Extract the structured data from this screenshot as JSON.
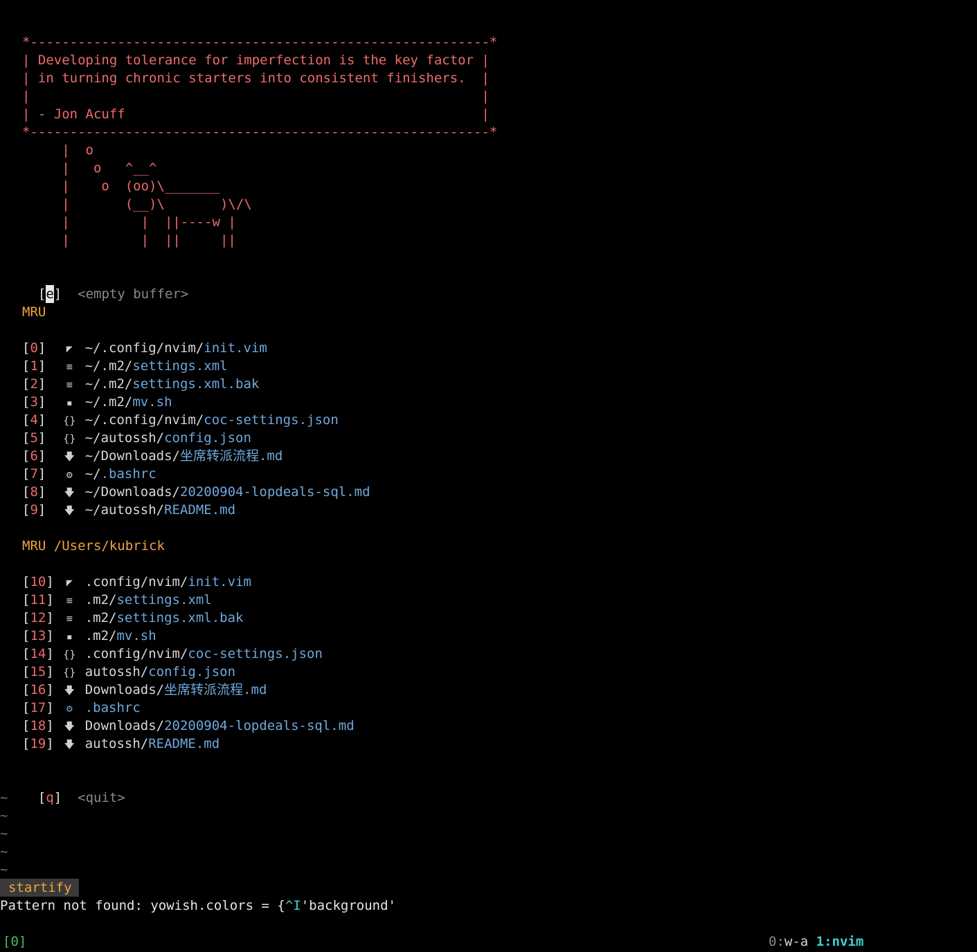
{
  "quote": {
    "border_top": "*----------------------------------------------------------*",
    "line1": "| Developing tolerance for imperfection is the key factor |",
    "line2": "| in turning chronic starters into consistent finishers.  |",
    "line3": "|                                                         |",
    "line4": "| - Jon Acuff                                             |",
    "border_bottom": "*----------------------------------------------------------*"
  },
  "cow": [
    "     |  o",
    "     |   o   ^__^",
    "     |    o  (oo)\\_______",
    "     |       (__)\\       )\\/\\",
    "     |         |  ||----w |",
    "     |         |  ||     ||"
  ],
  "empty_buffer": {
    "key": "e",
    "label": "<empty buffer>"
  },
  "mru": {
    "header": "MRU",
    "items": [
      {
        "index": "0",
        "icon": "vim-icon",
        "glyph": "◤",
        "dir": "~/.config/nvim/",
        "file": "init.vim"
      },
      {
        "index": "1",
        "icon": "file-lines-icon",
        "glyph": "≡",
        "dir": "~/.m2/",
        "file": "settings.xml"
      },
      {
        "index": "2",
        "icon": "file-lines-icon",
        "glyph": "≡",
        "dir": "~/.m2/",
        "file": "settings.xml.bak"
      },
      {
        "index": "3",
        "icon": "terminal-icon",
        "glyph": "▪",
        "dir": "~/.m2/",
        "file": "mv.sh"
      },
      {
        "index": "4",
        "icon": "braces-icon",
        "glyph": "{}",
        "dir": "~/.config/nvim/",
        "file": "coc-settings.json"
      },
      {
        "index": "5",
        "icon": "braces-icon",
        "glyph": "{}",
        "dir": "~/autossh/",
        "file": "config.json"
      },
      {
        "index": "6",
        "icon": "markdown-arrow-icon",
        "glyph": "🡇",
        "dir": "~/Downloads/",
        "file": "坐席转派流程.md"
      },
      {
        "index": "7",
        "icon": "gear-icon",
        "glyph": "⚙",
        "dir": "~/",
        "file": ".bashrc"
      },
      {
        "index": "8",
        "icon": "markdown-arrow-icon",
        "glyph": "🡇",
        "dir": "~/Downloads/",
        "file": "20200904-lopdeals-sql.md"
      },
      {
        "index": "9",
        "icon": "markdown-arrow-icon",
        "glyph": "🡇",
        "dir": "~/autossh/",
        "file": "README.md"
      }
    ]
  },
  "mru_dir": {
    "header": "MRU /Users/kubrick",
    "items": [
      {
        "index": "10",
        "icon": "vim-icon",
        "glyph": "◤",
        "dir": ".config/nvim/",
        "file": "init.vim"
      },
      {
        "index": "11",
        "icon": "file-lines-icon",
        "glyph": "≡",
        "dir": ".m2/",
        "file": "settings.xml"
      },
      {
        "index": "12",
        "icon": "file-lines-icon",
        "glyph": "≡",
        "dir": ".m2/",
        "file": "settings.xml.bak"
      },
      {
        "index": "13",
        "icon": "terminal-icon",
        "glyph": "▪",
        "dir": ".m2/",
        "file": "mv.sh"
      },
      {
        "index": "14",
        "icon": "braces-icon",
        "glyph": "{}",
        "dir": ".config/nvim/",
        "file": "coc-settings.json"
      },
      {
        "index": "15",
        "icon": "braces-icon",
        "glyph": "{}",
        "dir": "autossh/",
        "file": "config.json"
      },
      {
        "index": "16",
        "icon": "markdown-arrow-icon",
        "glyph": "🡇",
        "dir": "Downloads/",
        "file": "坐席转派流程.md"
      },
      {
        "index": "17",
        "icon": "gear-icon",
        "glyph": "⚙",
        "dir": "",
        "file": ".bashrc"
      },
      {
        "index": "18",
        "icon": "markdown-arrow-icon",
        "glyph": "🡇",
        "dir": "Downloads/",
        "file": "20200904-lopdeals-sql.md"
      },
      {
        "index": "19",
        "icon": "markdown-arrow-icon",
        "glyph": "🡇",
        "dir": "autossh/",
        "file": "README.md"
      }
    ]
  },
  "quit": {
    "key": "q",
    "label": "<quit>"
  },
  "tilde": "~",
  "statusline": {
    "filetype": "startify"
  },
  "message": {
    "prefix": "Pattern not found: yowish.colors = {",
    "special": "^I",
    "suffix": "'background'"
  },
  "tmux": {
    "session": "[0]",
    "window0_index": "0:",
    "window0_name": "w-a",
    "window1": "1:nvim"
  },
  "colors": {
    "background": "#000000",
    "accent_red": "#ef6b6b",
    "filename_blue": "#6fa8dc",
    "header_orange": "#f0a340",
    "cyan": "#3fd0d0",
    "green": "#3fbf5f"
  }
}
